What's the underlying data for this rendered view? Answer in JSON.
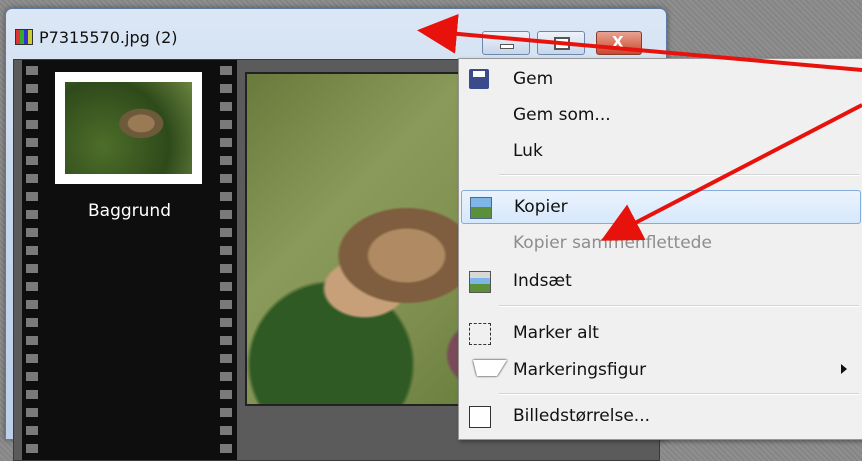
{
  "window": {
    "title": "P7315570.jpg (2)",
    "buttons": [
      "minimize",
      "maximize",
      "close"
    ],
    "close_glyph": "X"
  },
  "filmstrip": {
    "thumbnail_label": "Baggrund"
  },
  "context_menu": {
    "items": [
      {
        "label": "Gem",
        "icon": "save-icon",
        "enabled": true
      },
      {
        "label": "Gem som...",
        "icon": "",
        "enabled": true
      },
      {
        "label": "Luk",
        "icon": "",
        "enabled": true
      },
      {
        "label": "Kopier",
        "icon": "copy-image-icon",
        "enabled": true,
        "highlighted": true
      },
      {
        "label": "Kopier sammenflettede",
        "icon": "",
        "enabled": false
      },
      {
        "label": "Indsæt",
        "icon": "paste-image-icon",
        "enabled": true
      },
      {
        "label": "Marker alt",
        "icon": "select-all-icon",
        "enabled": true
      },
      {
        "label": "Markeringsfigur",
        "icon": "cursor-icon",
        "enabled": true,
        "submenu": true
      },
      {
        "label": "Billedstørrelse...",
        "icon": "resize-icon",
        "enabled": true
      }
    ]
  },
  "colors": {
    "annotation_arrow": "#e8120c",
    "menu_highlight": "#d6e8fb"
  }
}
